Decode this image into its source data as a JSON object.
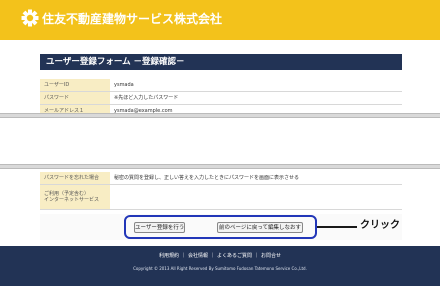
{
  "header": {
    "company_name": "住友不動産建物サービス株式会社",
    "logo_icon": "company-logo-icon",
    "colors": {
      "bar": "#f3c21b",
      "navy": "#223355"
    }
  },
  "form": {
    "title": "ユーザー登録フォーム －登録確認－",
    "rows_top": [
      {
        "label": "ユーザーID",
        "value": "ysmada"
      },
      {
        "label": "パスワード",
        "value": "※先ほど入力したパスワード"
      },
      {
        "label": "メールアドレス１",
        "value": "ysmada@example.com"
      }
    ],
    "rows_bottom": [
      {
        "label": "パスワードを忘れた場合",
        "value": "秘密の質問を登録し、正しい答えを入力したときにパスワードを画面に表示させる"
      },
      {
        "label_line1": "ご利用（予定含む）",
        "label_line2": "インターネットサービス",
        "value": ""
      }
    ]
  },
  "buttons": {
    "register": "ユーザー登録を行う",
    "back": "前のページに戻って編集しなおす"
  },
  "annotation": {
    "label": "クリック",
    "color": "#2236b8"
  },
  "footer": {
    "links": [
      "利用規約",
      "会社情報",
      "よくあるご質問",
      "お問合せ"
    ],
    "separator": "｜",
    "copyright": "Copyright © 2013 All Right Reserved By Sumitomo Fudosan Tatemono Service Co.,Ltd."
  }
}
